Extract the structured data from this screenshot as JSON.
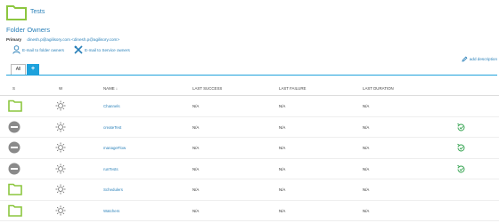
{
  "header": {
    "title": "Tests"
  },
  "owners": {
    "section_title": "Folder Owners",
    "primary_label": "Primary",
    "primary_value": "dinesh.p@agilisory.com <dinesh.p@agilisory.com>",
    "email_owners_label": "E-mail to folder owners",
    "email_service_label": "E-mail to Service owners"
  },
  "add_description_label": "add description",
  "tabs": {
    "all_label": "All",
    "add_label": "+"
  },
  "table": {
    "headers": {
      "s": "S",
      "w": "W",
      "name": "NAME ↓",
      "last_success": "LAST SUCCESS",
      "last_failure": "LAST FAILURE",
      "last_duration": "LAST DURATION"
    },
    "rows": [
      {
        "type": "folder",
        "name": "Channels",
        "last_success": "N/A",
        "last_failure": "N/A",
        "last_duration": "N/A",
        "build": false
      },
      {
        "type": "disabled",
        "name": "createTest",
        "last_success": "N/A",
        "last_failure": "N/A",
        "last_duration": "N/A",
        "build": true
      },
      {
        "type": "disabled",
        "name": "manageFlow",
        "last_success": "N/A",
        "last_failure": "N/A",
        "last_duration": "N/A",
        "build": true
      },
      {
        "type": "disabled",
        "name": "runTests",
        "last_success": "N/A",
        "last_failure": "N/A",
        "last_duration": "N/A",
        "build": true
      },
      {
        "type": "folder",
        "name": "Schedulers",
        "last_success": "N/A",
        "last_failure": "N/A",
        "last_duration": "N/A",
        "build": false
      },
      {
        "type": "folder",
        "name": "Watchers",
        "last_success": "N/A",
        "last_failure": "N/A",
        "last_duration": "N/A",
        "build": false
      }
    ]
  },
  "colors": {
    "accent": "#1ea2dc",
    "link": "#2a80b9",
    "folder": "#8cc63f",
    "disabled": "#8a8a8a",
    "build": "#3aa655"
  },
  "icons": {
    "status_folder": "folder-icon",
    "status_disabled": "disabled-icon",
    "weather": "sun-weather-icon",
    "build": "schedule-build-icon"
  }
}
